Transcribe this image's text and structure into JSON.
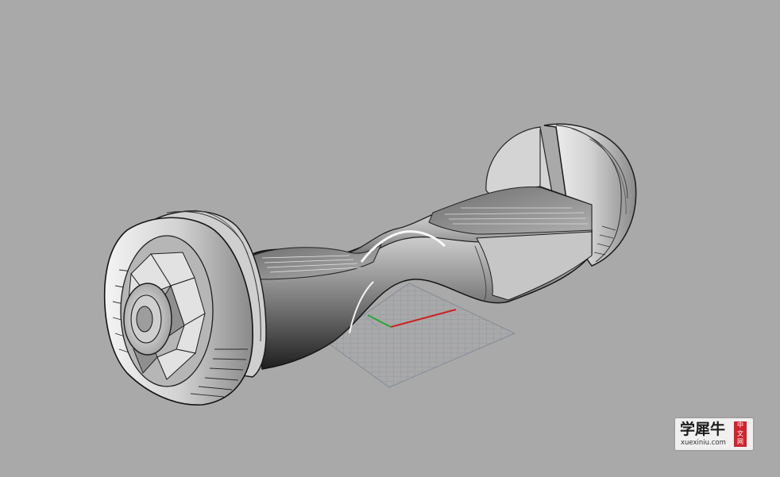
{
  "viewport": {
    "background": "#a9a9a9",
    "model": "hoverboard"
  },
  "watermark": {
    "cn_text": "学犀牛",
    "url": "xuexiniu.com",
    "seal": "中文网",
    "seal_color": "#d0232e"
  },
  "axes": {
    "x_color": "#cc2222",
    "y_color": "#22aa33"
  }
}
